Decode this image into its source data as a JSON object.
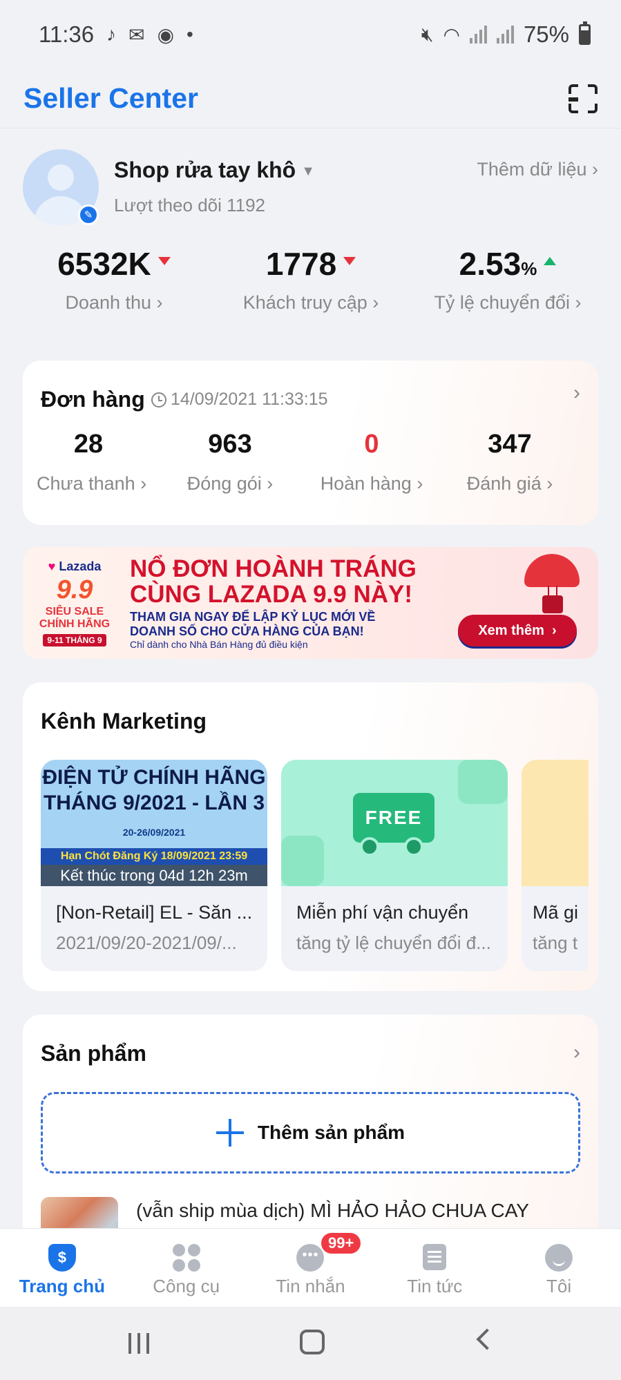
{
  "status_bar": {
    "time": "11:36",
    "battery": "75%"
  },
  "header": {
    "title": "Seller Center"
  },
  "shop": {
    "name": "Shop rửa tay khô",
    "followers": "Lượt theo dõi 1192",
    "add_data": "Thêm dữ liệu"
  },
  "metrics": [
    {
      "value": "6532K",
      "label": "Doanh thu",
      "trend": "down"
    },
    {
      "value": "1778",
      "label": "Khách truy cập",
      "trend": "down"
    },
    {
      "value": "2.53",
      "unit": "%",
      "label": "Tỷ lệ chuyển đổi",
      "trend": "up"
    }
  ],
  "orders": {
    "title": "Đơn hàng",
    "timestamp": "14/09/2021 11:33:15",
    "stats": [
      {
        "value": "28",
        "label": "Chưa thanh"
      },
      {
        "value": "963",
        "label": "Đóng gói"
      },
      {
        "value": "0",
        "label": "Hoàn hàng"
      },
      {
        "value": "347",
        "label": "Đánh giá"
      }
    ]
  },
  "banner": {
    "brand": "Lazada",
    "event": "9.9",
    "sale_line1": "SIÊU SALE",
    "sale_line2": "CHÍNH HÃNG",
    "date_tag": "9-11 THÁNG 9",
    "headline_1": "NỔ ĐƠN HOÀNH TRÁNG",
    "headline_2": "CÙNG LAZADA 9.9 NÀY!",
    "sub_1": "THAM GIA NGAY ĐỂ LẬP KỶ LỤC MỚI VỀ",
    "sub_2": "DOANH SỐ CHO CỬA HÀNG CỦA BẠN!",
    "note": "Chỉ dành cho Nhà Bán Hàng đủ điều kiện",
    "cta": "Xem thêm"
  },
  "marketing": {
    "title": "Kênh Marketing",
    "items": [
      {
        "image_line1": "ĐIỆN TỬ CHÍNH HÃNG",
        "image_line2": "THÁNG 9/2021 - LẦN 3",
        "image_dates": "20-26/09/2021",
        "image_deadline": "Hạn Chót Đăng Ký 18/09/2021 23:59",
        "countdown": "Kết thúc trong 04d 12h 23m",
        "title": "[Non-Retail] EL - Săn ...",
        "subtitle": "2021/09/20-2021/09/..."
      },
      {
        "image_text": "FREE",
        "title": "Miễn phí vận chuyển",
        "subtitle": "tăng tỷ lệ chuyển đổi đ..."
      },
      {
        "title": "Mã gi",
        "subtitle": "tăng t"
      }
    ]
  },
  "products": {
    "title": "Sản phẩm",
    "add_label": "Thêm sản phẩm",
    "first_item": "(vẫn ship mùa dịch)  MÌ HẢO HẢO CHUA CAY"
  },
  "bottom_nav": {
    "items": [
      {
        "label": "Trang chủ",
        "icon": "home-shield-icon",
        "active": true
      },
      {
        "label": "Công cụ",
        "icon": "tools-icon"
      },
      {
        "label": "Tin nhắn",
        "icon": "chat-icon",
        "badge": "99+"
      },
      {
        "label": "Tin tức",
        "icon": "news-icon"
      },
      {
        "label": "Tôi",
        "icon": "profile-icon"
      }
    ]
  },
  "colors": {
    "brand_blue": "#1a74e8",
    "alert_red": "#e5333b",
    "up_green": "#19b36b"
  }
}
